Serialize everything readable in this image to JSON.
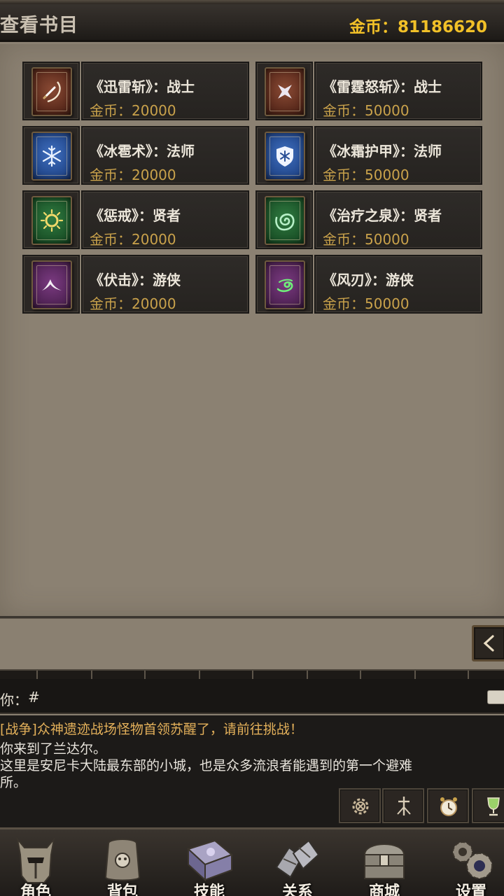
{
  "header": {
    "title": "查看书目",
    "gold_label": "金币：",
    "gold_value": "81186620"
  },
  "books": [
    {
      "name": "《迅雷斩》：战士",
      "price": "金币：20000",
      "color": "red",
      "icon": "slash-icon"
    },
    {
      "name": "《雷霆怒斩》：战士",
      "price": "金币：50000",
      "color": "red",
      "icon": "star-cross-icon"
    },
    {
      "name": "《冰雹术》：法师",
      "price": "金币：20000",
      "color": "blue",
      "icon": "snowflake-icon"
    },
    {
      "name": "《冰霜护甲》：法师",
      "price": "金币：50000",
      "color": "blue",
      "icon": "frost-shield-icon"
    },
    {
      "name": "《惩戒》：贤者",
      "price": "金币：20000",
      "color": "green",
      "icon": "sun-icon"
    },
    {
      "name": "《治疗之泉》：贤者",
      "price": "金币：50000",
      "color": "green",
      "icon": "swirl-icon"
    },
    {
      "name": "《伏击》：游侠",
      "price": "金币：20000",
      "color": "purple",
      "icon": "claw-icon"
    },
    {
      "name": "《风刃》：游侠",
      "price": "金币：50000",
      "color": "purple",
      "icon": "wind-icon"
    }
  ],
  "input": {
    "prompt": "你：",
    "value": "#"
  },
  "log": {
    "line1": "[战争]众神遗迹战场怪物首领苏醒了，请前往挑战！",
    "line2": "你来到了兰达尔。",
    "line3": "这里是安尼卡大陆最东部的小城，也是众多流浪者能遇到的第一个避难",
    "line4": "所。"
  },
  "quick_buttons": [
    "settings-gear-icon",
    "sword-icon",
    "alarm-clock-icon",
    "trophy-icon"
  ],
  "nav": [
    {
      "label": "角色",
      "icon": "helmet-icon"
    },
    {
      "label": "背包",
      "icon": "backpack-icon"
    },
    {
      "label": "技能",
      "icon": "spellbook-icon"
    },
    {
      "label": "关系",
      "icon": "gauntlets-icon"
    },
    {
      "label": "商城",
      "icon": "treasure-chest-icon"
    },
    {
      "label": "设置",
      "icon": "gears-icon"
    }
  ],
  "colors": {
    "gold": "#f2c128",
    "price": "#c9a24b",
    "war_text": "#e3b05a"
  }
}
